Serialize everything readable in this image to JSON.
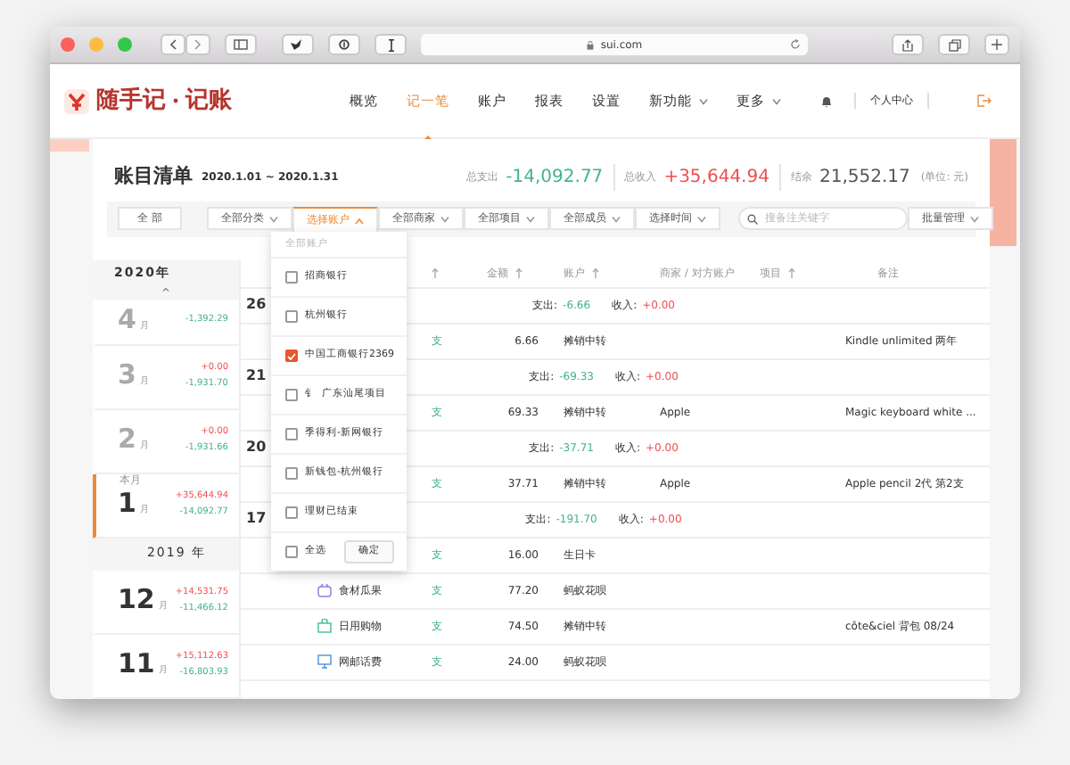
{
  "browser": {
    "url": "sui.com"
  },
  "nav": {
    "logo_text": "随手记",
    "logo_sub": "记账",
    "user": "个人中心",
    "items": [
      {
        "label": "概览",
        "selected": false,
        "dropdown": false
      },
      {
        "label": "记一笔",
        "selected": true,
        "dropdown": false
      },
      {
        "label": "账户",
        "selected": false,
        "dropdown": false
      },
      {
        "label": "报表",
        "selected": false,
        "dropdown": false
      },
      {
        "label": "设置",
        "selected": false,
        "dropdown": false
      },
      {
        "label": "新功能",
        "selected": false,
        "dropdown": true
      },
      {
        "label": "更多",
        "selected": false,
        "dropdown": true
      }
    ]
  },
  "ledger": {
    "title": "账目清单",
    "range": "2020.1.01 ~ 2020.1.31",
    "unit": "(单位: 元)",
    "totals": [
      {
        "label": "总支出",
        "value": "-14,092.77",
        "kind": "expense"
      },
      {
        "label": "总收入",
        "value": "+35,644.94",
        "kind": "income"
      },
      {
        "label": "结余",
        "value": "21,552.17",
        "kind": "balance"
      }
    ]
  },
  "filters": [
    {
      "label": "全 部",
      "kind": "plain",
      "expanded": false
    },
    {
      "label": "全部分类",
      "kind": "dropdown",
      "expanded": false
    },
    {
      "label": "选择账户",
      "kind": "dropdown",
      "expanded": true
    },
    {
      "label": "全部商家",
      "kind": "dropdown",
      "expanded": false
    },
    {
      "label": "全部项目",
      "kind": "dropdown",
      "expanded": false
    },
    {
      "label": "全部成员",
      "kind": "dropdown",
      "expanded": false
    },
    {
      "label": "选择时间",
      "kind": "dropdown",
      "expanded": false
    }
  ],
  "search": {
    "placeholder": "搜备注关键字"
  },
  "batch": {
    "label": "批量管理"
  },
  "account_menu": {
    "header": "全部账户",
    "select_all": "全选",
    "select_all_checked": false,
    "confirm": "确定",
    "items": [
      {
        "label": "招商银行",
        "checked": false
      },
      {
        "label": "杭州银行",
        "checked": false
      },
      {
        "label": "中国工商银行2369",
        "checked": true
      },
      {
        "label": "钅  广东汕尾项目",
        "checked": false
      },
      {
        "label": "季得利-新网银行",
        "checked": false
      },
      {
        "label": "新钱包-杭州银行",
        "checked": false
      },
      {
        "label": "理财已结束",
        "checked": false
      }
    ]
  },
  "months": [
    {
      "kind": "year",
      "label": "2020年"
    },
    {
      "kind": "scroll_up",
      "label": "^"
    },
    {
      "kind": "month",
      "partial": true,
      "number": "4",
      "unit": "月",
      "expense": "-1,392.29",
      "selected": false
    },
    {
      "kind": "month",
      "number": "3",
      "unit": "月",
      "income": "+0.00",
      "expense": "-1,931.70",
      "selected": false
    },
    {
      "kind": "month",
      "number": "2",
      "unit": "月",
      "income": "+0.00",
      "expense": "-1,931.66",
      "selected": false
    },
    {
      "kind": "month",
      "number": "1",
      "unit": "月",
      "tag": "本月",
      "income": "+35,644.94",
      "expense": "-14,092.77",
      "selected": true
    },
    {
      "kind": "year",
      "label": "2019 年"
    },
    {
      "kind": "month",
      "number": "12",
      "unit": "月",
      "income": "+14,531.75",
      "expense": "-11,466.12",
      "selected": false
    },
    {
      "kind": "month",
      "number": "11",
      "unit": "月",
      "income": "+15,112.63",
      "expense": "-16,803.93",
      "selected": false
    }
  ],
  "table": {
    "columns": [
      {
        "sortable": true
      },
      {
        "label": "金额",
        "sortable": true
      },
      {
        "label": "账户",
        "sortable": true
      },
      {
        "label": "商家 / 对方账户",
        "sortable": false
      },
      {
        "label": "项目",
        "sortable": true
      },
      {
        "label": "备注",
        "sortable": false
      }
    ],
    "groups": [
      {
        "date": "26",
        "expense_label": "支出:",
        "expense": "-6.66",
        "income_label": "收入:",
        "income": "+0.00",
        "rows": [
          {
            "type": "支",
            "amount": "6.66",
            "account": "摊销中转",
            "note": "Kindle unlimited 两年"
          }
        ]
      },
      {
        "date": "21",
        "expense_label": "支出:",
        "expense": "-69.33",
        "income_label": "收入:",
        "income": "+0.00",
        "rows": [
          {
            "type": "支",
            "amount": "69.33",
            "account": "摊销中转",
            "merchant": "Apple",
            "note": "Magic keyboard white ..."
          }
        ]
      },
      {
        "date": "20",
        "expense_label": "支出:",
        "expense": "-37.71",
        "income_label": "收入:",
        "income": "+0.00",
        "rows": [
          {
            "type": "支",
            "amount": "37.71",
            "account": "摊销中转",
            "merchant": "Apple",
            "note": "Apple pencil 2代 第2支"
          }
        ]
      },
      {
        "date": "17",
        "expense_label": "支出:",
        "expense": "-191.70",
        "income_label": "收入:",
        "income": "+0.00",
        "rows": [
          {
            "type": "支",
            "amount": "16.00",
            "account": "生日卡"
          },
          {
            "type": "支",
            "amount": "77.20",
            "account": "蚂蚁花呗",
            "category": "食材瓜果",
            "kind": "basket"
          },
          {
            "type": "支",
            "amount": "74.50",
            "account": "摊销中转",
            "category": "日用购物",
            "kind": "bag",
            "note": "côte&ciel 背包 08/24"
          },
          {
            "type": "支",
            "amount": "24.00",
            "account": "蚂蚁花呗",
            "category": "网邮话费",
            "kind": "monitor"
          }
        ]
      }
    ]
  }
}
